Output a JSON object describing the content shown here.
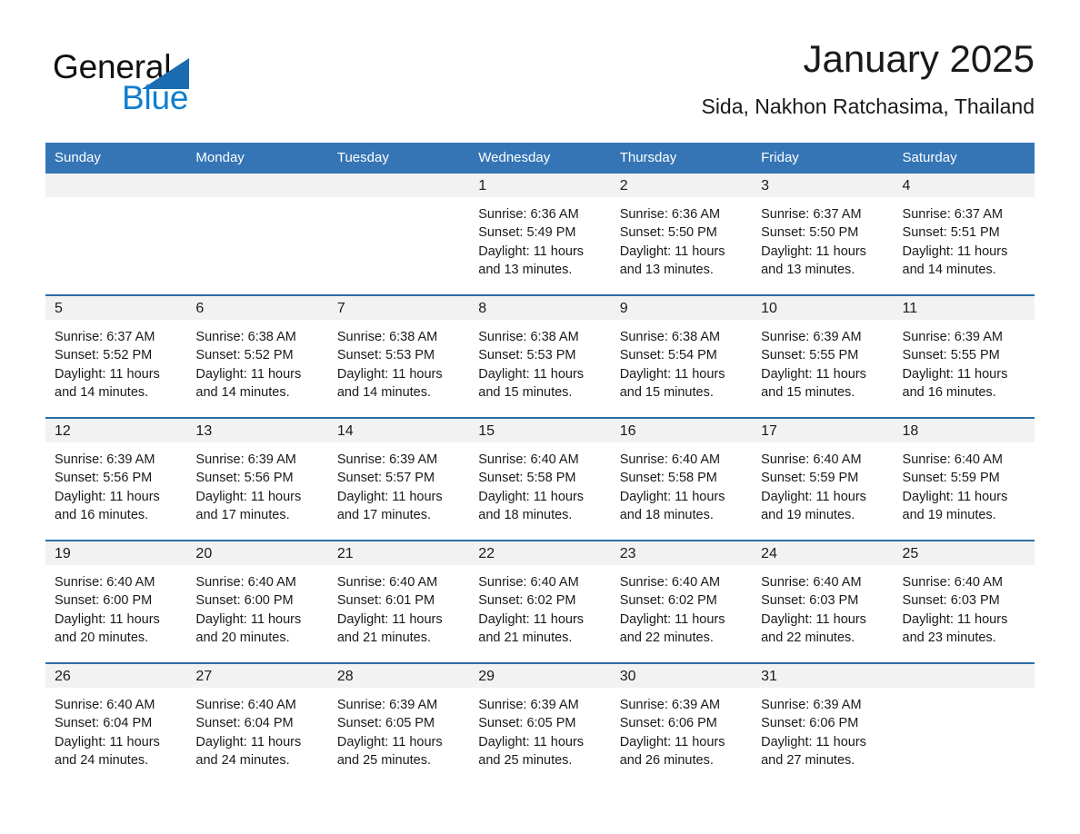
{
  "brand": {
    "name_part1": "General",
    "name_part2": "Blue",
    "triangle_color": "#1b6cb0"
  },
  "header": {
    "month_title": "January 2025",
    "location": "Sida, Nakhon Ratchasima, Thailand"
  },
  "theme": {
    "header_blue": "#3575b5",
    "row_border_blue": "#2d6da4",
    "daynum_band": "#f2f2f2",
    "text": "#1a1a1a"
  },
  "weekday_headers": [
    "Sunday",
    "Monday",
    "Tuesday",
    "Wednesday",
    "Thursday",
    "Friday",
    "Saturday"
  ],
  "weeks": [
    [
      {
        "day": "",
        "sunrise": "",
        "sunset": "",
        "daylight": "",
        "daylight2": ""
      },
      {
        "day": "",
        "sunrise": "",
        "sunset": "",
        "daylight": "",
        "daylight2": ""
      },
      {
        "day": "",
        "sunrise": "",
        "sunset": "",
        "daylight": "",
        "daylight2": ""
      },
      {
        "day": "1",
        "sunrise": "Sunrise: 6:36 AM",
        "sunset": "Sunset: 5:49 PM",
        "daylight": "Daylight: 11 hours",
        "daylight2": "and 13 minutes."
      },
      {
        "day": "2",
        "sunrise": "Sunrise: 6:36 AM",
        "sunset": "Sunset: 5:50 PM",
        "daylight": "Daylight: 11 hours",
        "daylight2": "and 13 minutes."
      },
      {
        "day": "3",
        "sunrise": "Sunrise: 6:37 AM",
        "sunset": "Sunset: 5:50 PM",
        "daylight": "Daylight: 11 hours",
        "daylight2": "and 13 minutes."
      },
      {
        "day": "4",
        "sunrise": "Sunrise: 6:37 AM",
        "sunset": "Sunset: 5:51 PM",
        "daylight": "Daylight: 11 hours",
        "daylight2": "and 14 minutes."
      }
    ],
    [
      {
        "day": "5",
        "sunrise": "Sunrise: 6:37 AM",
        "sunset": "Sunset: 5:52 PM",
        "daylight": "Daylight: 11 hours",
        "daylight2": "and 14 minutes."
      },
      {
        "day": "6",
        "sunrise": "Sunrise: 6:38 AM",
        "sunset": "Sunset: 5:52 PM",
        "daylight": "Daylight: 11 hours",
        "daylight2": "and 14 minutes."
      },
      {
        "day": "7",
        "sunrise": "Sunrise: 6:38 AM",
        "sunset": "Sunset: 5:53 PM",
        "daylight": "Daylight: 11 hours",
        "daylight2": "and 14 minutes."
      },
      {
        "day": "8",
        "sunrise": "Sunrise: 6:38 AM",
        "sunset": "Sunset: 5:53 PM",
        "daylight": "Daylight: 11 hours",
        "daylight2": "and 15 minutes."
      },
      {
        "day": "9",
        "sunrise": "Sunrise: 6:38 AM",
        "sunset": "Sunset: 5:54 PM",
        "daylight": "Daylight: 11 hours",
        "daylight2": "and 15 minutes."
      },
      {
        "day": "10",
        "sunrise": "Sunrise: 6:39 AM",
        "sunset": "Sunset: 5:55 PM",
        "daylight": "Daylight: 11 hours",
        "daylight2": "and 15 minutes."
      },
      {
        "day": "11",
        "sunrise": "Sunrise: 6:39 AM",
        "sunset": "Sunset: 5:55 PM",
        "daylight": "Daylight: 11 hours",
        "daylight2": "and 16 minutes."
      }
    ],
    [
      {
        "day": "12",
        "sunrise": "Sunrise: 6:39 AM",
        "sunset": "Sunset: 5:56 PM",
        "daylight": "Daylight: 11 hours",
        "daylight2": "and 16 minutes."
      },
      {
        "day": "13",
        "sunrise": "Sunrise: 6:39 AM",
        "sunset": "Sunset: 5:56 PM",
        "daylight": "Daylight: 11 hours",
        "daylight2": "and 17 minutes."
      },
      {
        "day": "14",
        "sunrise": "Sunrise: 6:39 AM",
        "sunset": "Sunset: 5:57 PM",
        "daylight": "Daylight: 11 hours",
        "daylight2": "and 17 minutes."
      },
      {
        "day": "15",
        "sunrise": "Sunrise: 6:40 AM",
        "sunset": "Sunset: 5:58 PM",
        "daylight": "Daylight: 11 hours",
        "daylight2": "and 18 minutes."
      },
      {
        "day": "16",
        "sunrise": "Sunrise: 6:40 AM",
        "sunset": "Sunset: 5:58 PM",
        "daylight": "Daylight: 11 hours",
        "daylight2": "and 18 minutes."
      },
      {
        "day": "17",
        "sunrise": "Sunrise: 6:40 AM",
        "sunset": "Sunset: 5:59 PM",
        "daylight": "Daylight: 11 hours",
        "daylight2": "and 19 minutes."
      },
      {
        "day": "18",
        "sunrise": "Sunrise: 6:40 AM",
        "sunset": "Sunset: 5:59 PM",
        "daylight": "Daylight: 11 hours",
        "daylight2": "and 19 minutes."
      }
    ],
    [
      {
        "day": "19",
        "sunrise": "Sunrise: 6:40 AM",
        "sunset": "Sunset: 6:00 PM",
        "daylight": "Daylight: 11 hours",
        "daylight2": "and 20 minutes."
      },
      {
        "day": "20",
        "sunrise": "Sunrise: 6:40 AM",
        "sunset": "Sunset: 6:00 PM",
        "daylight": "Daylight: 11 hours",
        "daylight2": "and 20 minutes."
      },
      {
        "day": "21",
        "sunrise": "Sunrise: 6:40 AM",
        "sunset": "Sunset: 6:01 PM",
        "daylight": "Daylight: 11 hours",
        "daylight2": "and 21 minutes."
      },
      {
        "day": "22",
        "sunrise": "Sunrise: 6:40 AM",
        "sunset": "Sunset: 6:02 PM",
        "daylight": "Daylight: 11 hours",
        "daylight2": "and 21 minutes."
      },
      {
        "day": "23",
        "sunrise": "Sunrise: 6:40 AM",
        "sunset": "Sunset: 6:02 PM",
        "daylight": "Daylight: 11 hours",
        "daylight2": "and 22 minutes."
      },
      {
        "day": "24",
        "sunrise": "Sunrise: 6:40 AM",
        "sunset": "Sunset: 6:03 PM",
        "daylight": "Daylight: 11 hours",
        "daylight2": "and 22 minutes."
      },
      {
        "day": "25",
        "sunrise": "Sunrise: 6:40 AM",
        "sunset": "Sunset: 6:03 PM",
        "daylight": "Daylight: 11 hours",
        "daylight2": "and 23 minutes."
      }
    ],
    [
      {
        "day": "26",
        "sunrise": "Sunrise: 6:40 AM",
        "sunset": "Sunset: 6:04 PM",
        "daylight": "Daylight: 11 hours",
        "daylight2": "and 24 minutes."
      },
      {
        "day": "27",
        "sunrise": "Sunrise: 6:40 AM",
        "sunset": "Sunset: 6:04 PM",
        "daylight": "Daylight: 11 hours",
        "daylight2": "and 24 minutes."
      },
      {
        "day": "28",
        "sunrise": "Sunrise: 6:39 AM",
        "sunset": "Sunset: 6:05 PM",
        "daylight": "Daylight: 11 hours",
        "daylight2": "and 25 minutes."
      },
      {
        "day": "29",
        "sunrise": "Sunrise: 6:39 AM",
        "sunset": "Sunset: 6:05 PM",
        "daylight": "Daylight: 11 hours",
        "daylight2": "and 25 minutes."
      },
      {
        "day": "30",
        "sunrise": "Sunrise: 6:39 AM",
        "sunset": "Sunset: 6:06 PM",
        "daylight": "Daylight: 11 hours",
        "daylight2": "and 26 minutes."
      },
      {
        "day": "31",
        "sunrise": "Sunrise: 6:39 AM",
        "sunset": "Sunset: 6:06 PM",
        "daylight": "Daylight: 11 hours",
        "daylight2": "and 27 minutes."
      },
      {
        "day": "",
        "sunrise": "",
        "sunset": "",
        "daylight": "",
        "daylight2": ""
      }
    ]
  ]
}
